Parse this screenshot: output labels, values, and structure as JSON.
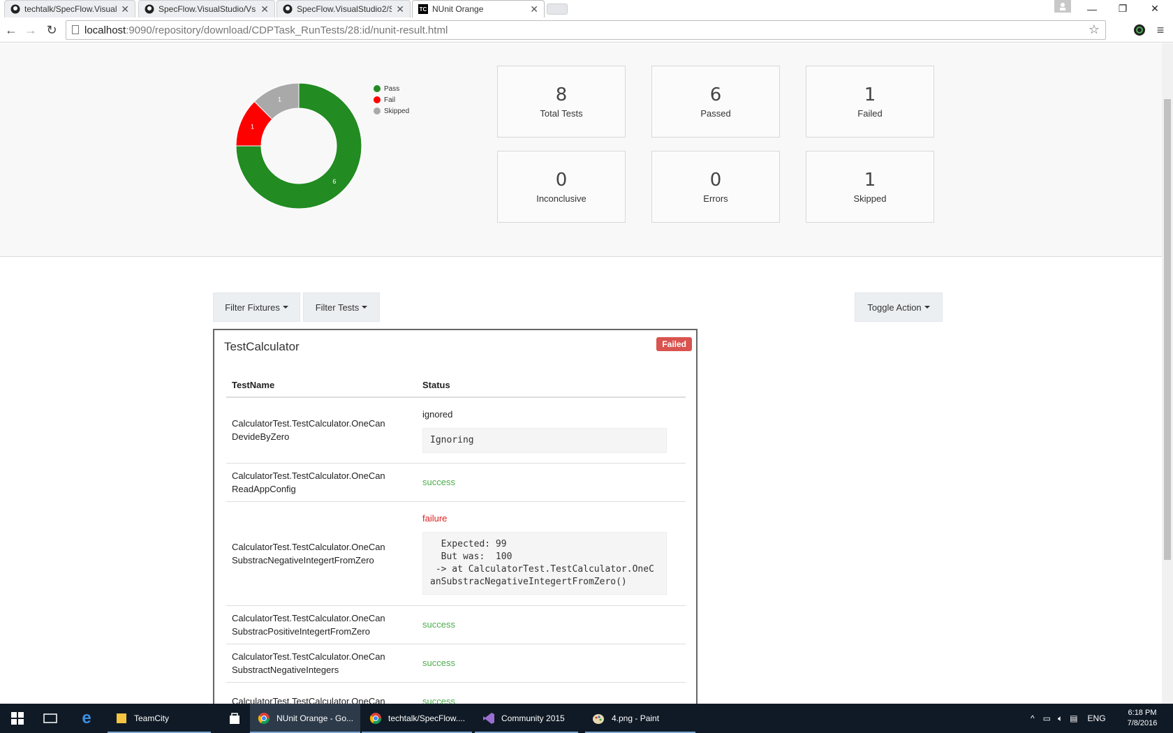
{
  "browser": {
    "tabs": [
      {
        "label": "techtalk/SpecFlow.VisualS",
        "icon": "github-icon"
      },
      {
        "label": "SpecFlow.VisualStudio/Vs",
        "icon": "github-icon"
      },
      {
        "label": "SpecFlow.VisualStudio2/S",
        "icon": "github-icon"
      },
      {
        "label": "NUnit Orange",
        "icon": "teamcity-icon",
        "icon_text": "TC"
      }
    ],
    "url_host": "localhost",
    "url_rest": ":9090/repository/download/CDPTask_RunTests/28:id/nunit-result.html"
  },
  "chart_data": {
    "type": "pie",
    "donut": true,
    "categories": [
      "Pass",
      "Fail",
      "Skipped"
    ],
    "values": [
      6,
      1,
      1
    ],
    "colors": [
      "#228b22",
      "#ff0000",
      "#a9a9a9"
    ],
    "legend": "top-right"
  },
  "stats": [
    {
      "value": "8",
      "label": "Total Tests"
    },
    {
      "value": "6",
      "label": "Passed"
    },
    {
      "value": "1",
      "label": "Failed"
    },
    {
      "value": "0",
      "label": "Inconclusive"
    },
    {
      "value": "0",
      "label": "Errors"
    },
    {
      "value": "1",
      "label": "Skipped"
    }
  ],
  "controls": {
    "filter_fixtures": "Filter Fixtures",
    "filter_tests": "Filter Tests",
    "toggle_action": "Toggle Action"
  },
  "fixture": {
    "title": "TestCalculator",
    "badge": "Failed",
    "columns": [
      "TestName",
      "Status"
    ],
    "rows": [
      {
        "name1": "CalculatorTest.TestCalculator.OneCan",
        "name2": "DevideByZero",
        "status": "ignored",
        "message": "Ignoring"
      },
      {
        "name1": "CalculatorTest.TestCalculator.OneCan",
        "name2": "ReadAppConfig",
        "status": "success",
        "message": ""
      },
      {
        "name1": "CalculatorTest.TestCalculator.OneCan",
        "name2": "SubstracNegativeIntegertFromZero",
        "status": "failure",
        "message": "  Expected: 99\n  But was:  100\n -> at CalculatorTest.TestCalculator.OneCanSubstracNegativeIntegertFromZero()"
      },
      {
        "name1": "CalculatorTest.TestCalculator.OneCan",
        "name2": "SubstracPositiveIntegertFromZero",
        "status": "success",
        "message": ""
      },
      {
        "name1": "CalculatorTest.TestCalculator.OneCan",
        "name2": "SubstractNegativeIntegers",
        "status": "success",
        "message": ""
      },
      {
        "name1": "CalculatorTest.TestCalculator.OneCan",
        "name2": "",
        "status": "success",
        "message": ""
      }
    ]
  },
  "taskbar": {
    "items": [
      {
        "label": "TeamCity",
        "icon": "folder-icon"
      },
      {
        "label": "NUnit Orange - Go...",
        "icon": "chrome-icon"
      },
      {
        "label": "techtalk/SpecFlow....",
        "icon": "chrome-icon"
      },
      {
        "label": "Community 2015",
        "icon": "visual-studio-icon"
      },
      {
        "label": "4.png - Paint",
        "icon": "paint-icon"
      }
    ],
    "lang": "ENG",
    "time": "6:18 PM",
    "date": "7/8/2016"
  }
}
